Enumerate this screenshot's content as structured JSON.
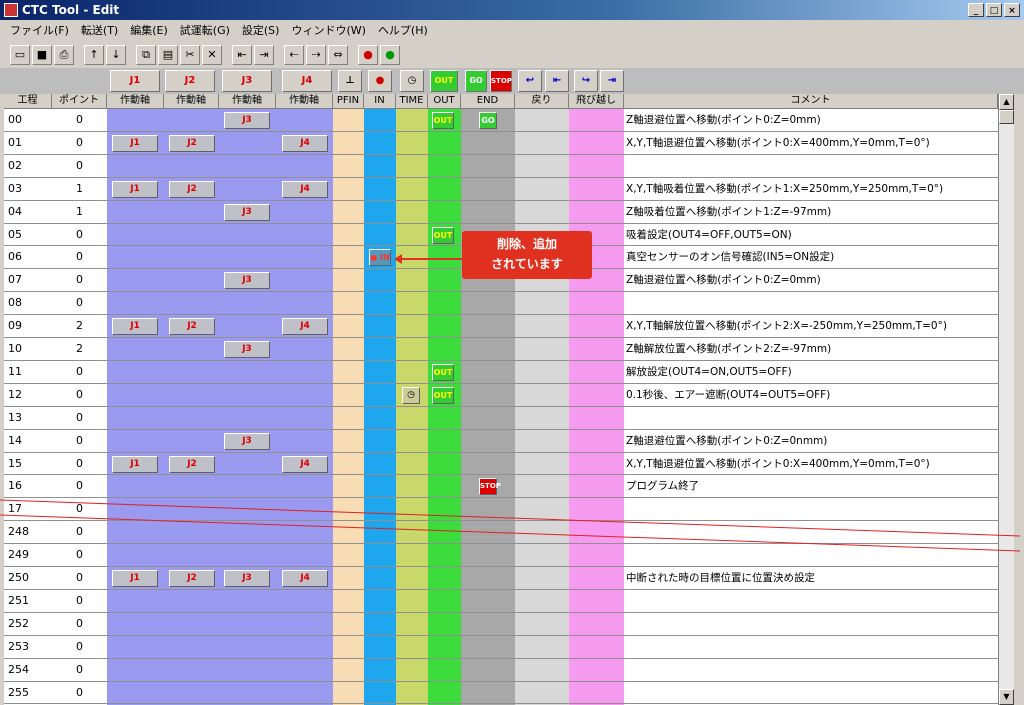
{
  "window": {
    "title": "CTC Tool - Edit"
  },
  "menu": [
    "ファイル(F)",
    "転送(T)",
    "編集(E)",
    "試運転(G)",
    "設定(S)",
    "ウィンドウ(W)",
    "ヘルプ(H)"
  ],
  "toolbar_icons": [
    "open-icon",
    "save-icon",
    "print-icon",
    "arrow-up-icon",
    "arrow-down-icon",
    "copy-icon",
    "paste-icon",
    "cut-icon",
    "delete-icon",
    "insert-left-icon",
    "insert-right-icon",
    "shift-left-icon",
    "shift-right-icon",
    "shift-all-icon",
    "signal-red-icon",
    "signal-green-icon"
  ],
  "command_icons": {
    "j1": "J1",
    "j2": "J2",
    "j3": "J3",
    "j4": "J4",
    "out": "OUT",
    "go": "GO",
    "stop": "STOP"
  },
  "headers": [
    "工程",
    "ポイント",
    "作動軸",
    "作動軸",
    "作動軸",
    "作動軸",
    "PFIN",
    "IN",
    "TIME",
    "OUT",
    "END",
    "戻り",
    "飛び越し",
    "コメント"
  ],
  "rows": [
    {
      "step": "00",
      "point": "0",
      "j3": true,
      "out": true,
      "go": true,
      "comment": "Z軸退避位置へ移動(ポイント0:Z=0mm)"
    },
    {
      "step": "01",
      "point": "0",
      "j1": true,
      "j2": true,
      "j4": true,
      "comment": "X,Y,T軸退避位置へ移動(ポイント0:X=400mm,Y=0mm,T=0°)"
    },
    {
      "step": "02",
      "point": "0",
      "comment": ""
    },
    {
      "step": "03",
      "point": "1",
      "j1": true,
      "j2": true,
      "j4": true,
      "comment": "X,Y,T軸吸着位置へ移動(ポイント1:X=250mm,Y=250mm,T=0°)"
    },
    {
      "step": "04",
      "point": "1",
      "j3": true,
      "comment": "Z軸吸着位置へ移動(ポイント1:Z=-97mm)"
    },
    {
      "step": "05",
      "point": "0",
      "out": true,
      "comment": "吸着設定(OUT4=OFF,OUT5=ON)"
    },
    {
      "step": "06",
      "point": "0",
      "in": true,
      "comment": "真空センサーのオン信号確認(IN5=ON設定)"
    },
    {
      "step": "07",
      "point": "0",
      "j3": true,
      "comment": "Z軸退避位置へ移動(ポイント0:Z=0mm)"
    },
    {
      "step": "08",
      "point": "0",
      "comment": ""
    },
    {
      "step": "09",
      "point": "2",
      "j1": true,
      "j2": true,
      "j4": true,
      "comment": "X,Y,T軸解放位置へ移動(ポイント2:X=-250mm,Y=250mm,T=0°)"
    },
    {
      "step": "10",
      "point": "2",
      "j3": true,
      "comment": "Z軸解放位置へ移動(ポイント2:Z=-97mm)"
    },
    {
      "step": "11",
      "point": "0",
      "out": true,
      "comment": "解放設定(OUT4=ON,OUT5=OFF)"
    },
    {
      "step": "12",
      "point": "0",
      "time": true,
      "out": true,
      "comment": "0.1秒後、エアー遮断(OUT4=OUT5=OFF)"
    },
    {
      "step": "13",
      "point": "0",
      "comment": ""
    },
    {
      "step": "14",
      "point": "0",
      "j3": true,
      "comment": "Z軸退避位置へ移動(ポイント0:Z=0nmm)"
    },
    {
      "step": "15",
      "point": "0",
      "j1": true,
      "j2": true,
      "j4": true,
      "comment": "X,Y,T軸退避位置へ移動(ポイント0:X=400mm,Y=0mm,T=0°)"
    },
    {
      "step": "16",
      "point": "0",
      "stop": true,
      "comment": "プログラム終了"
    },
    {
      "step": "17",
      "point": "0",
      "comment": ""
    },
    {
      "step": "248",
      "point": "0",
      "comment": ""
    },
    {
      "step": "249",
      "point": "0",
      "comment": ""
    },
    {
      "step": "250",
      "point": "0",
      "j1": true,
      "j2": true,
      "j3": true,
      "j4": true,
      "comment": "中断された時の目標位置に位置決め設定"
    },
    {
      "step": "251",
      "point": "0",
      "comment": ""
    },
    {
      "step": "252",
      "point": "0",
      "comment": ""
    },
    {
      "step": "253",
      "point": "0",
      "comment": ""
    },
    {
      "step": "254",
      "point": "0",
      "comment": ""
    },
    {
      "step": "255",
      "point": "0",
      "comment": ""
    }
  ],
  "callout": {
    "line1": "削除、追加",
    "line2": "されています"
  },
  "colors": {
    "axis_cols": "#9a9af0",
    "pfin": "#f7dcb4",
    "in": "#1ea6ee",
    "time": "#c8d86a",
    "out": "#3ddc3d",
    "end": "#a8a8a8",
    "ret": "#d8d8d8",
    "jump": "#f59cf0",
    "callout": "#e03020"
  }
}
